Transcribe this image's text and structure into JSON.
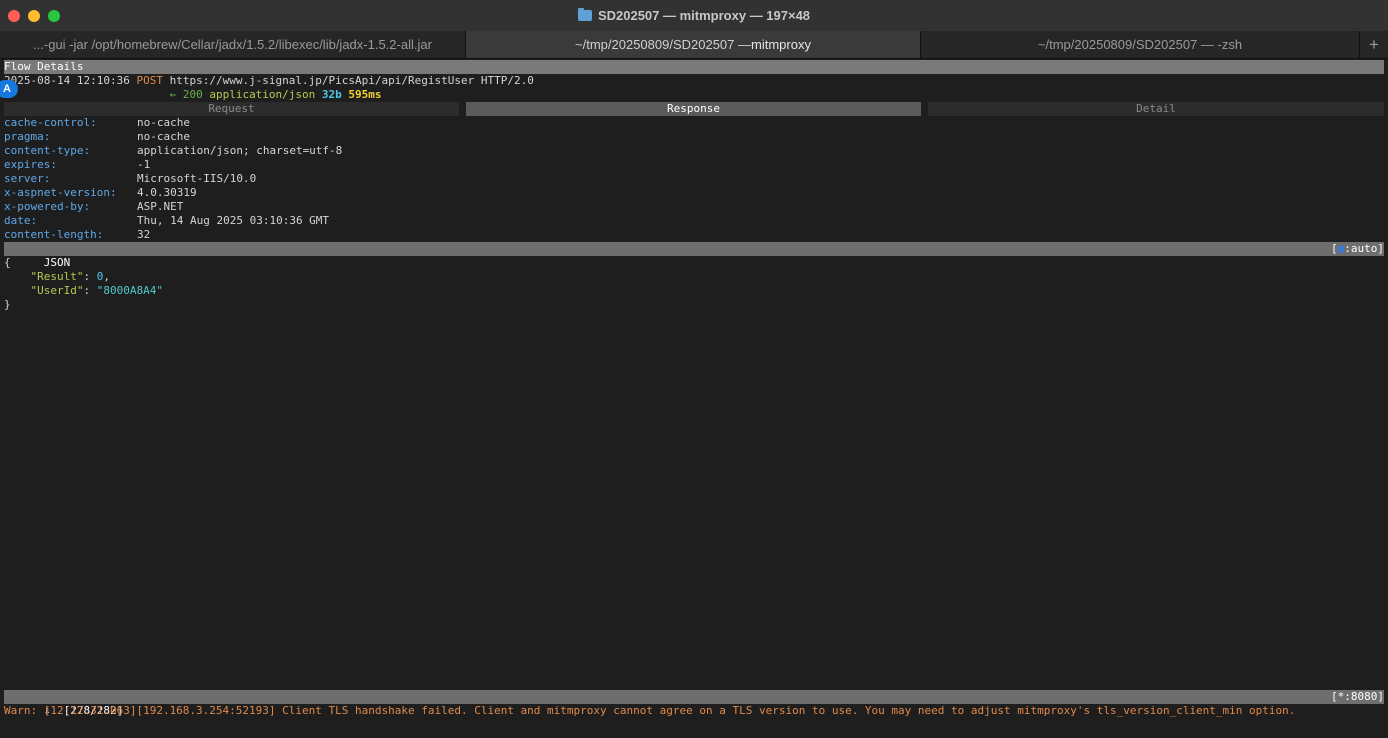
{
  "window": {
    "title": "SD202507 — mitmproxy — 197×48",
    "tabs": [
      {
        "label": "...-gui -jar /opt/homebrew/Cellar/jadx/1.5.2/libexec/lib/jadx-1.5.2-all.jar"
      },
      {
        "label_prefix": "~/tmp/20250809/SD202507 — ",
        "label_main": "mitmproxy"
      },
      {
        "label": "~/tmp/20250809/SD202507 — -zsh"
      }
    ],
    "new_tab": "+"
  },
  "flow": {
    "header": "Flow Details",
    "timestamp": "2025-08-14 12:10:36",
    "method": "POST",
    "url": "https://www.j-signal.jp/PicsApi/api/RegistUser HTTP/2.0",
    "arrow_status": "← 200",
    "content_type": "application/json",
    "size": "32b",
    "duration": "595ms",
    "badge": "A"
  },
  "subtabs": [
    "Request",
    "Response",
    "Detail"
  ],
  "headers": [
    {
      "key": "cache-control:",
      "value": "no-cache"
    },
    {
      "key": "pragma:",
      "value": "no-cache"
    },
    {
      "key": "content-type:",
      "value": "application/json; charset=utf-8"
    },
    {
      "key": "expires:",
      "value": "-1"
    },
    {
      "key": "server:",
      "value": "Microsoft-IIS/10.0"
    },
    {
      "key": "x-aspnet-version:",
      "value": "4.0.30319"
    },
    {
      "key": "x-powered-by:",
      "value": "ASP.NET"
    },
    {
      "key": "date:",
      "value": "Thu, 14 Aug 2025 03:10:36 GMT"
    },
    {
      "key": "content-length:",
      "value": "32"
    }
  ],
  "body": {
    "view_label": "JSON",
    "mode_open": "[",
    "mode_dot": "■",
    "mode_close": ":auto]",
    "open_brace": "{",
    "close_brace": "}",
    "line1_key": "\"Result\"",
    "line1_colon": ": ",
    "line1_value": "0",
    "line1_comma": ",",
    "line2_key": "\"UserId\"",
    "line2_colon": ": ",
    "line2_value": "\"8000A8A4\""
  },
  "statusbar": {
    "left": "⇩  [278/282]",
    "right": "[*:8080]"
  },
  "message": "Warn: [12:12:31.063][192.168.3.254:52193] Client TLS handshake failed. Client and mitmproxy cannot agree on a TLS version to use. You may need to adjust mitmproxy's tls_version_client_min option."
}
